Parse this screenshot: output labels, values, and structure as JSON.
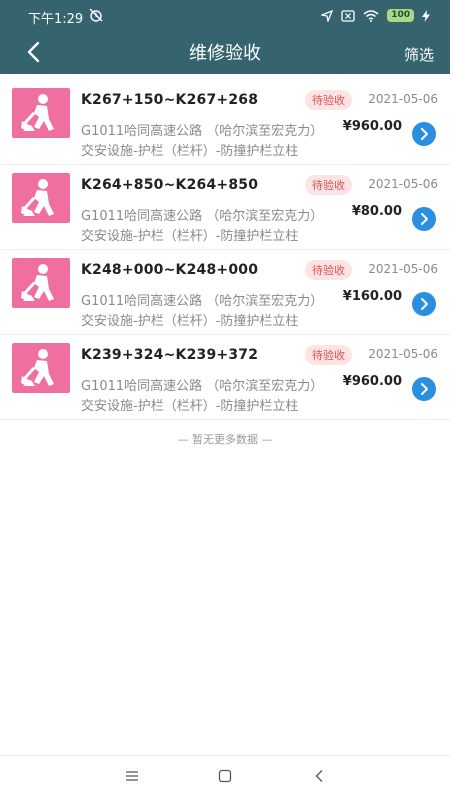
{
  "status": {
    "time": "下午1:29",
    "battery": "100"
  },
  "header": {
    "title": "维修验收",
    "filter_label": "筛选"
  },
  "items": [
    {
      "code": "K267+150~K267+268",
      "status": "待验收",
      "date": "2021-05-06",
      "road": "G1011哈同高速公路 （哈尔滨至宏克力）",
      "price": "¥960.00",
      "type": "交安设施-护栏（栏杆）-防撞护栏立柱"
    },
    {
      "code": "K264+850~K264+850",
      "status": "待验收",
      "date": "2021-05-06",
      "road": "G1011哈同高速公路 （哈尔滨至宏克力）",
      "price": "¥80.00",
      "type": "交安设施-护栏（栏杆）-防撞护栏立柱"
    },
    {
      "code": "K248+000~K248+000",
      "status": "待验收",
      "date": "2021-05-06",
      "road": "G1011哈同高速公路 （哈尔滨至宏克力）",
      "price": "¥160.00",
      "type": "交安设施-护栏（栏杆）-防撞护栏立柱"
    },
    {
      "code": "K239+324~K239+372",
      "status": "待验收",
      "date": "2021-05-06",
      "road": "G1011哈同高速公路 （哈尔滨至宏克力）",
      "price": "¥960.00",
      "type": "交安设施-护栏（栏杆）-防撞护栏立柱"
    }
  ],
  "footer": {
    "no_more": "— 暂无更多数据 —"
  },
  "colors": {
    "header_bg": "#35646f",
    "thumb_bg": "#ef6fa0",
    "badge_text": "#d9534f",
    "arrow_bg": "#2a8fe0"
  },
  "icons": {
    "back": "chevron-left-icon",
    "item": "road-worker-icon",
    "go": "chevron-right-icon"
  }
}
